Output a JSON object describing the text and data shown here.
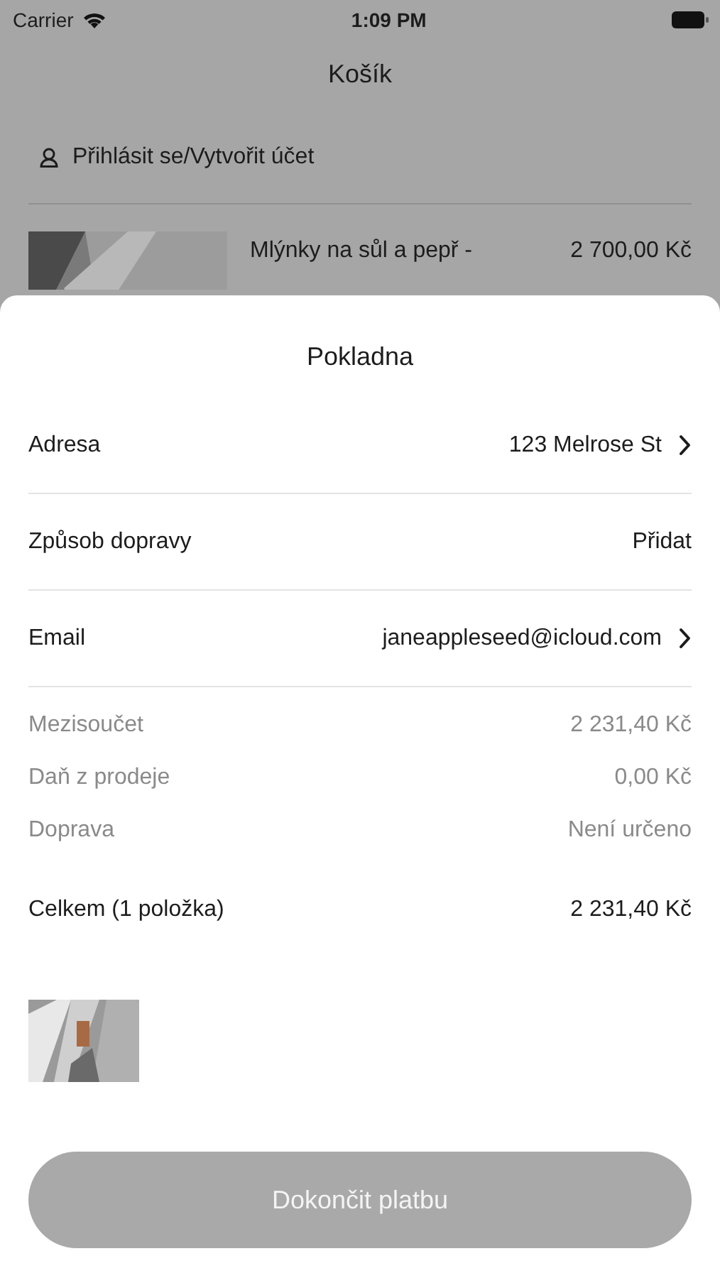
{
  "status_bar": {
    "carrier": "Carrier",
    "time": "1:09 PM"
  },
  "cart": {
    "title": "Košík",
    "account_link": "Přihlásit se/Vytvořit účet",
    "item": {
      "name": "Mlýnky na sůl a pepř -",
      "price": "2 700,00 Kč"
    }
  },
  "checkout": {
    "title": "Pokladna",
    "rows": [
      {
        "label": "Adresa",
        "value": "123 Melrose St",
        "chevron": true
      },
      {
        "label": "Způsob dopravy",
        "value": "Přidat",
        "chevron": false
      },
      {
        "label": "Email",
        "value": "janeappleseed@icloud.com",
        "chevron": true
      }
    ],
    "summary": [
      {
        "label": "Mezisoučet",
        "value": "2 231,40 Kč"
      },
      {
        "label": "Daň z prodeje",
        "value": "0,00 Kč"
      },
      {
        "label": "Doprava",
        "value": "Není určeno"
      }
    ],
    "total": {
      "label": "Celkem (1 položka)",
      "value": "2 231,40 Kč"
    },
    "pay_button": {
      "label": "Dokončit platbu",
      "disabled": true
    }
  }
}
